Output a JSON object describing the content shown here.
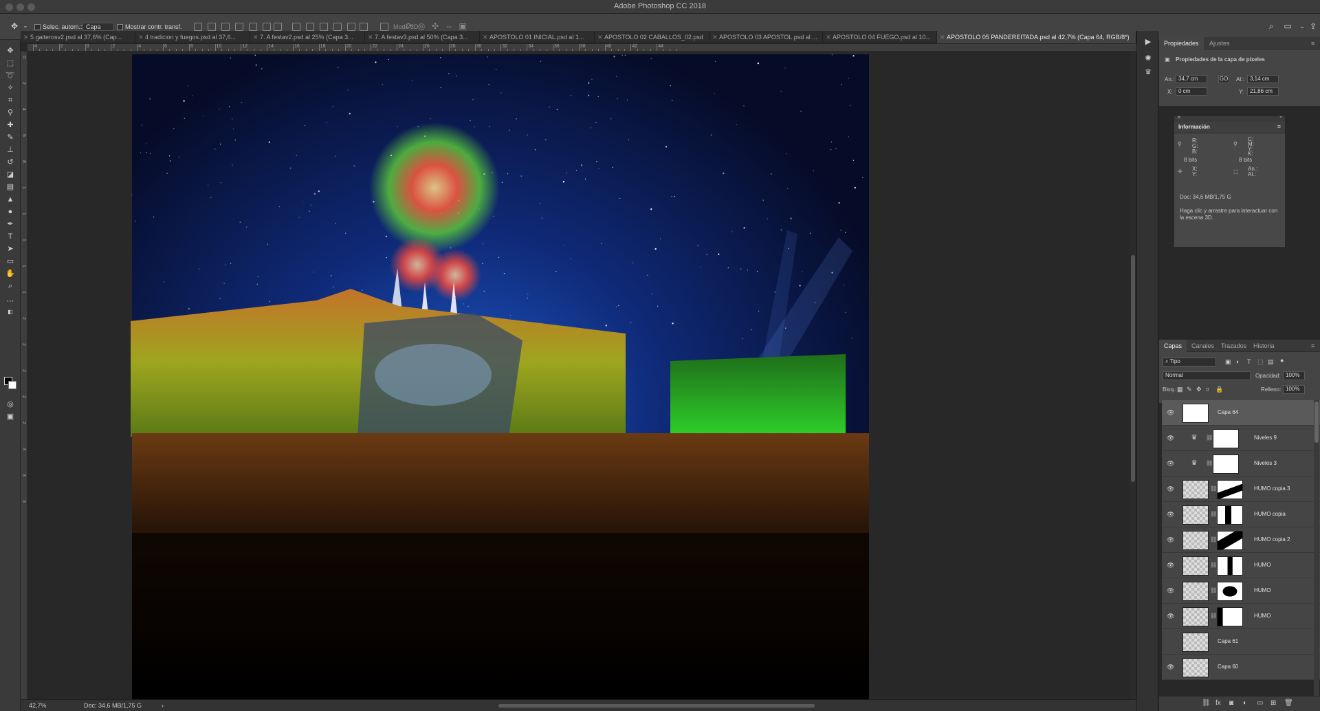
{
  "app": {
    "title": "Adobe Photoshop CC 2018"
  },
  "options": {
    "auto_select_label": "Selec. autom.:",
    "auto_select_value": "Capa",
    "show_transform_label": "Mostrar contr. transf.",
    "mode_3d_label": "Modo 3D:"
  },
  "tabs": [
    {
      "label": "5 gaiterosv2.psd al 37,6% (Cap..."
    },
    {
      "label": "4 tradicion y fuegos.psd al 37,6..."
    },
    {
      "label": "7. A festav2.psd al 25% (Capa 3..."
    },
    {
      "label": "7. A festav3.psd al 50% (Capa 3..."
    },
    {
      "label": "APOSTOLO 01 INICIAL.psd al 1..."
    },
    {
      "label": "APOSTOLO 02 CABALLOS_02.psd"
    },
    {
      "label": "APOSTOLO 03 APOSTOL.psd al ..."
    },
    {
      "label": "APOSTOLO 04 FUEGO.psd al 10..."
    },
    {
      "label": "APOSTOLO 05 PANDEREITADA.psd al 42,7% (Capa 64, RGB/8*)"
    }
  ],
  "rulers": {
    "h_labels": [
      "4",
      "2",
      "0",
      "2",
      "4",
      "6",
      "8",
      "10",
      "12",
      "14",
      "16",
      "18",
      "20",
      "22",
      "24",
      "26",
      "28",
      "30",
      "32",
      "34",
      "36",
      "38",
      "40",
      "42",
      "44"
    ],
    "v_labels": [
      "0",
      "2",
      "4",
      "6",
      "8",
      "1",
      "1",
      "1",
      "1",
      "1",
      "2",
      "2",
      "2",
      "2",
      "2",
      "3",
      "3",
      "3"
    ]
  },
  "status": {
    "zoom": "42,7%",
    "doc": "Doc: 34,6 MB/1,75 G"
  },
  "properties": {
    "tab_active": "Propiedades",
    "tab_other": "Ajustes",
    "heading": "Propiedades de la capa de píxeles",
    "w_label": "An.:",
    "w_value": "34,7 cm",
    "link_label": "GO",
    "h_label": "Al.:",
    "h_value": "3,14 cm",
    "x_label": "X:",
    "x_value": "0 cm",
    "y_label": "Y:",
    "y_value": "21,86 cm"
  },
  "info": {
    "title": "Información",
    "rgb": "R:\nG:\nB:",
    "cmyk": "C:\nM:\nY:\nK:",
    "bits_left": "8 bits",
    "bits_right": "8 bits",
    "xy": "X:\nY:",
    "wh": "An.:\nAl.:",
    "doc": "Doc: 34,6 MB/1,75 G",
    "hint": "Haga clic y arrastre para interactuar con la escena 3D."
  },
  "layers_panel": {
    "tabs": [
      "Capas",
      "Canales",
      "Trazados",
      "Historia"
    ],
    "filter": "Tipo",
    "blend": "Normal",
    "opacity_label": "Opacidad:",
    "opacity_value": "100%",
    "lock_label": "Bloq.:",
    "fill_label": "Relleno:",
    "fill_value": "100%",
    "layers": [
      {
        "name": "Capa 64",
        "kind": "pixel"
      },
      {
        "name": "Niveles 9",
        "kind": "adjust"
      },
      {
        "name": "Niveles 3",
        "kind": "adjust"
      },
      {
        "name": "HUMO copia 3",
        "kind": "masked"
      },
      {
        "name": "HUMO copia",
        "kind": "masked"
      },
      {
        "name": "HUMO copia 2",
        "kind": "masked"
      },
      {
        "name": "HUMO",
        "kind": "masked"
      },
      {
        "name": "HUMO",
        "kind": "masked"
      },
      {
        "name": "HUMO",
        "kind": "masked"
      },
      {
        "name": "Capa 61",
        "kind": "pixel"
      },
      {
        "name": "Capa 60",
        "kind": "pixel"
      }
    ]
  }
}
